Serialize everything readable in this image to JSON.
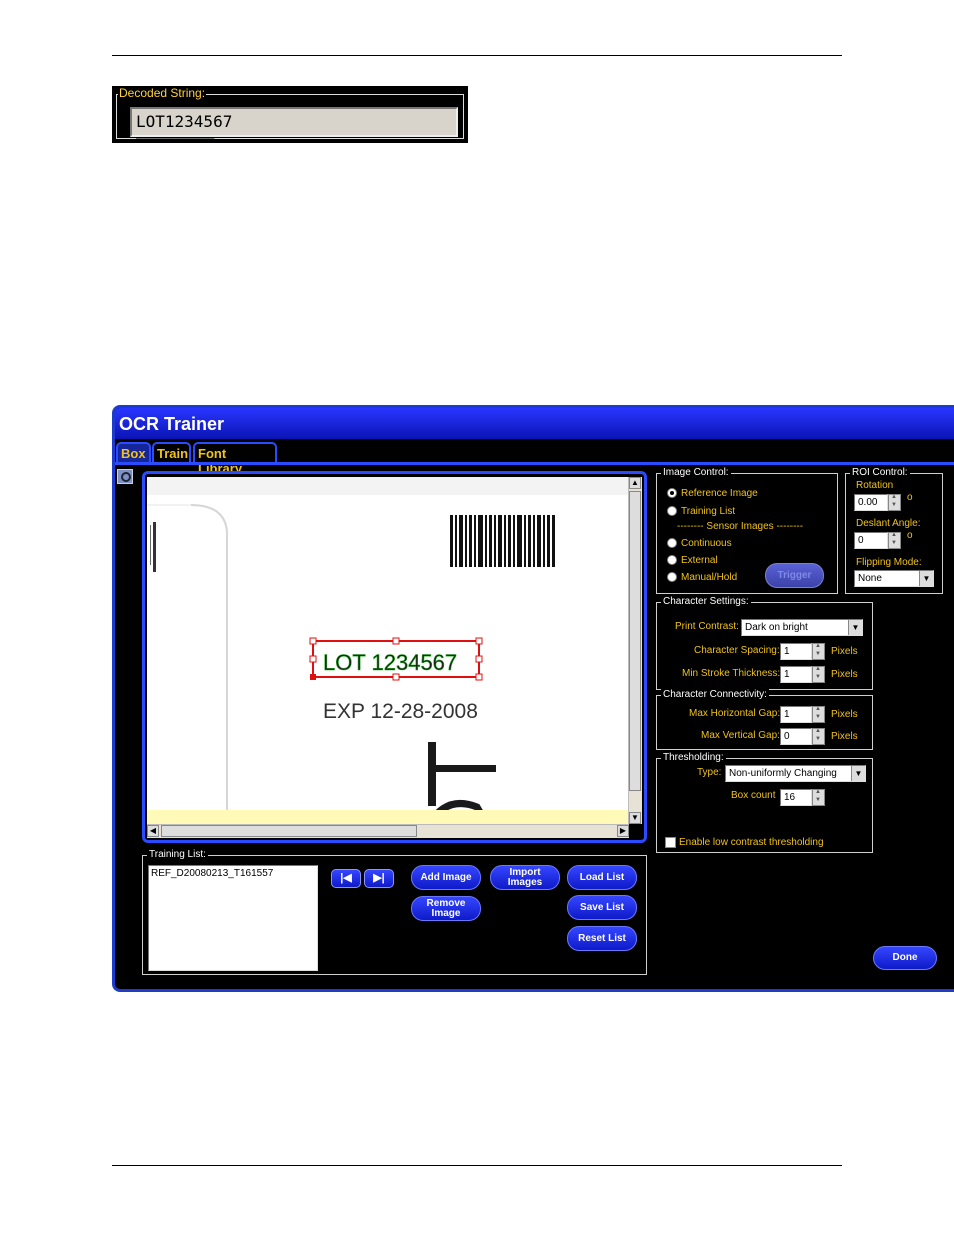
{
  "decoded": {
    "label": "Decoded String:",
    "value": "LOT1234567"
  },
  "window": {
    "title": "OCR Trainer",
    "tabs": [
      {
        "label": "Box",
        "active": true
      },
      {
        "label": "Train",
        "active": false
      },
      {
        "label": "Font Library",
        "active": false
      }
    ]
  },
  "image": {
    "ocr_text": "LOT 1234567",
    "exp_text": "EXP 12-28-2008",
    "big_letter": "T"
  },
  "image_control": {
    "title": "Image Control:",
    "options": [
      "Reference Image",
      "Training List"
    ],
    "sensor_header": "-------- Sensor Images --------",
    "sensor_options": [
      "Continuous",
      "External",
      "Manual/Hold"
    ],
    "selected": "Reference Image",
    "trigger_label": "Trigger"
  },
  "roi_control": {
    "title": "ROI Control:",
    "rotation_label": "Rotation",
    "rotation_value": "0.00",
    "deslant_label": "Deslant Angle:",
    "deslant_value": "0",
    "degree_symbol": "o",
    "flipping_label": "Flipping Mode:",
    "flipping_value": "None"
  },
  "character_settings": {
    "title": "Character Settings:",
    "print_contrast_label": "Print Contrast:",
    "print_contrast_value": "Dark on bright",
    "spacing_label": "Character Spacing:",
    "spacing_value": "1",
    "stroke_label": "Min Stroke Thickness:",
    "stroke_value": "1",
    "unit": "Pixels"
  },
  "connectivity": {
    "title": "Character Connectivity:",
    "hgap_label": "Max Horizontal Gap:",
    "hgap_value": "1",
    "vgap_label": "Max Vertical Gap:",
    "vgap_value": "0",
    "unit": "Pixels"
  },
  "thresholding": {
    "title": "Thresholding:",
    "type_label": "Type:",
    "type_value": "Non-uniformly Changing",
    "box_label": "Box count",
    "box_value": "16",
    "low_contrast_label": "Enable low contrast thresholding"
  },
  "training_list": {
    "title": "Training List:",
    "items": [
      "REF_D20080213_T161557"
    ],
    "first_icon": "skip-first",
    "last_icon": "skip-last",
    "add_image": "Add Image",
    "remove_image": "Remove Image",
    "import_images": "Import Images",
    "load_list": "Load List",
    "save_list": "Save List",
    "reset_list": "Reset List"
  },
  "done_label": "Done"
}
